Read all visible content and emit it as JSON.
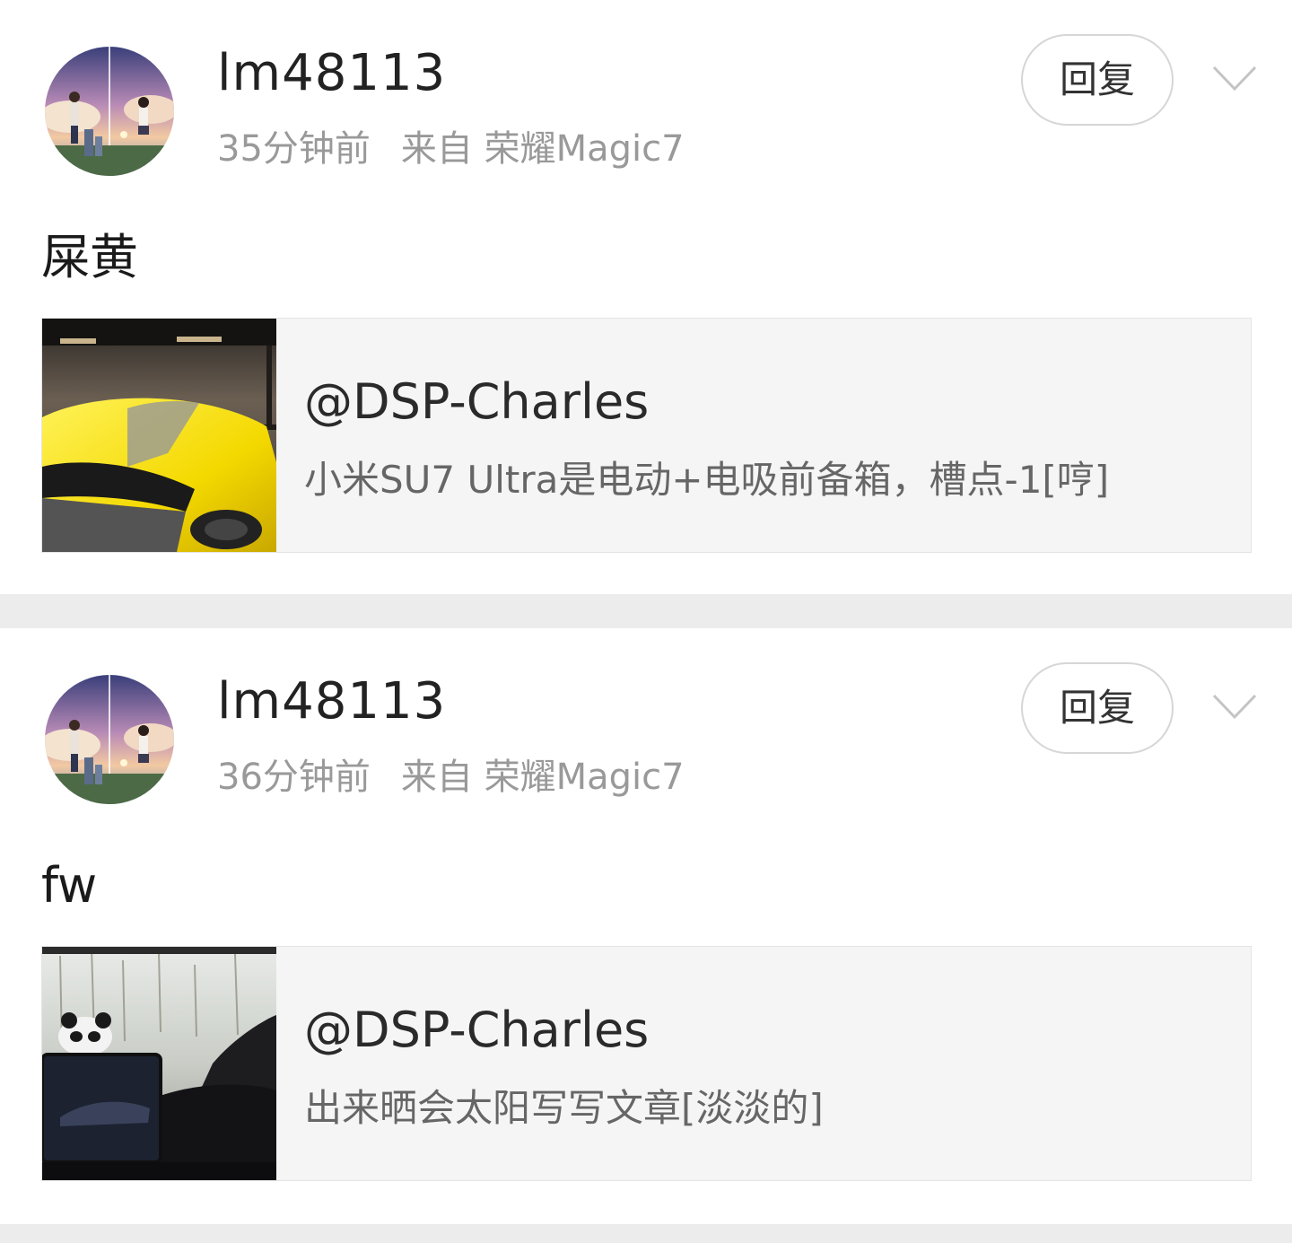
{
  "comments": [
    {
      "username": "lm48113",
      "time": "35分钟前",
      "source": "来自 荣耀Magic7",
      "reply_label": "回复",
      "content": "屎黄",
      "quote": {
        "author": "@DSP-Charles",
        "text": "小米SU7 Ultra是电动+电吸前备箱，槽点-1[哼]"
      }
    },
    {
      "username": "lm48113",
      "time": "36分钟前",
      "source": "来自 荣耀Magic7",
      "reply_label": "回复",
      "content": "fw",
      "quote": {
        "author": "@DSP-Charles",
        "text": "出来晒会太阳写写文章[淡淡的]"
      }
    }
  ],
  "colors": {
    "page_background": "#ececec",
    "card_background": "#ffffff",
    "meta_text": "#999999",
    "quote_background": "#f5f5f5"
  },
  "icons": {
    "expand": "chevron-down-icon"
  }
}
